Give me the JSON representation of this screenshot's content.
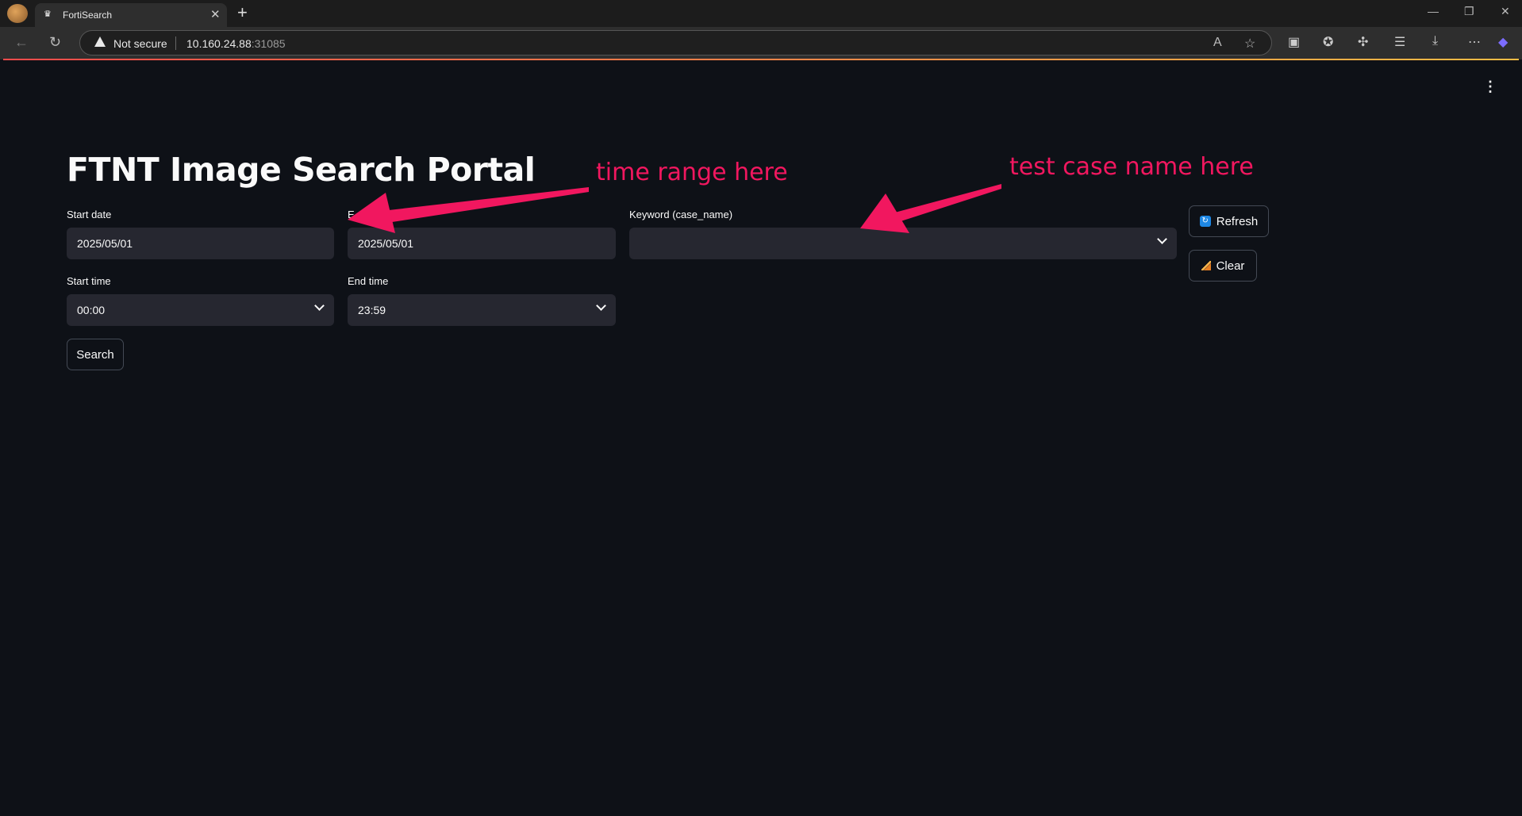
{
  "browser": {
    "tab_title": "FortiSearch",
    "tab_favicon_icon": "crown-icon",
    "address": {
      "security_label": "Not secure",
      "host": "10.160.24.88",
      "port": ":31085"
    }
  },
  "app": {
    "title": "FTNT Image Search Portal",
    "start_date": {
      "label": "Start date",
      "value": "2025/05/01"
    },
    "end_date": {
      "label": "E",
      "value": "2025/05/01"
    },
    "keyword": {
      "label": "Keyword (case_name)",
      "value": ""
    },
    "start_time": {
      "label": "Start time",
      "value": "00:00"
    },
    "end_time": {
      "label": "End time",
      "value": "23:59"
    },
    "search_label": "Search",
    "refresh_label": "Refresh",
    "clear_label": "Clear"
  },
  "annotations": {
    "time_range": "time range here",
    "test_case": "test case name here",
    "color": "#f1175f"
  }
}
